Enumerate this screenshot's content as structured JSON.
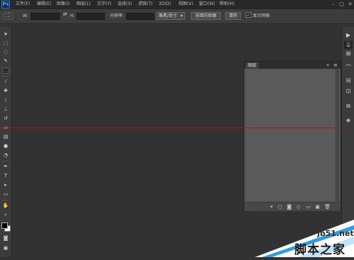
{
  "app": {
    "logo_text": "Ps"
  },
  "menu": {
    "items": [
      "文件(F)",
      "编辑(E)",
      "图像(I)",
      "图层(L)",
      "文字(Y)",
      "选择(S)",
      "滤镜(T)",
      "3D(D)",
      "视图(V)",
      "窗口(W)",
      "帮助(H)"
    ]
  },
  "window_controls": {
    "minimize": "–",
    "restore": "▢",
    "close": "✕"
  },
  "options_bar": {
    "w_label": "W:",
    "h_label": "H:",
    "resolution_label": "分辨率:",
    "unit_select": "像素/英寸",
    "front_image_button": "前面的图像",
    "clear_button": "清除",
    "show_cropped_checkbox": "显示网格",
    "show_cropped_checked": true
  },
  "layers_panel": {
    "tab_label": "图层",
    "collapse_icon": "»",
    "menu_icon": "≡",
    "footer_icons": [
      "link-icon",
      "fx-icon",
      "mask-icon",
      "adjustment-icon",
      "group-icon",
      "new-layer-icon",
      "trash-icon"
    ]
  },
  "colors": {
    "background": "#323232",
    "guide_line": "#b2121e",
    "panel": "#535353",
    "accent": "#2e7bd1"
  },
  "watermark": {
    "site": "jb51.net",
    "caption": "脚本之家"
  }
}
